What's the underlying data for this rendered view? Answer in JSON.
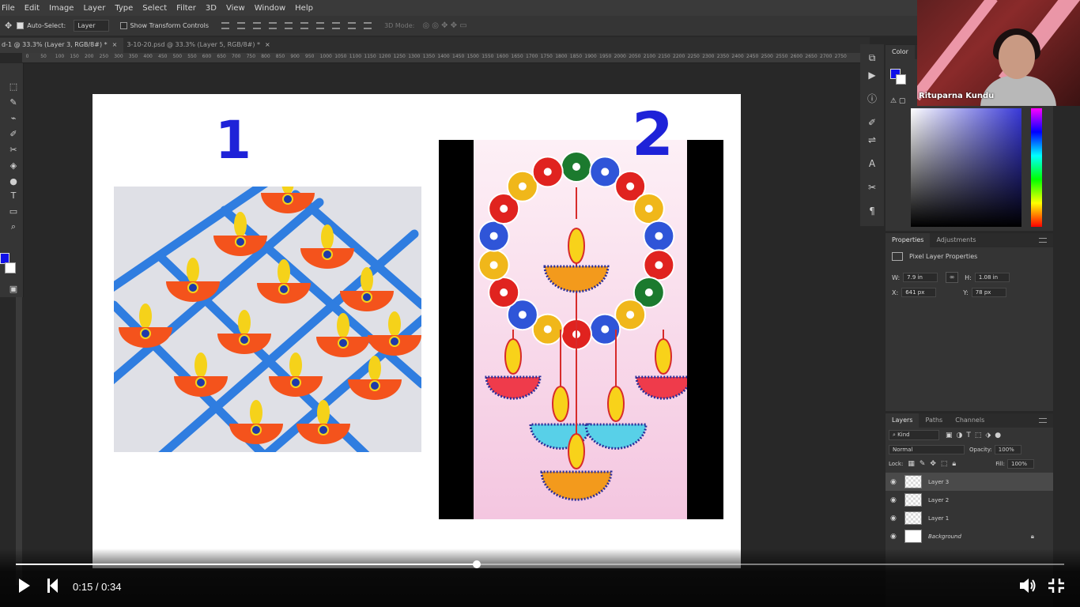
{
  "menu": [
    "File",
    "Edit",
    "Image",
    "Layer",
    "Type",
    "Select",
    "Filter",
    "3D",
    "View",
    "Window",
    "Help"
  ],
  "options": {
    "auto_select": "Auto-Select:",
    "auto_select_target": "Layer",
    "show_transform": "Show Transform Controls",
    "mode_3d": "3D Mode:"
  },
  "tabs": [
    {
      "label": "d-1 @ 33.3% (Layer 3, RGB/8#) *"
    },
    {
      "label": "3-10-20.psd @ 33.3% (Layer 5, RGB/8#) *"
    }
  ],
  "ruler": [
    "50",
    "0",
    "50",
    "100",
    "150",
    "200",
    "250",
    "300",
    "350",
    "400",
    "450",
    "500",
    "550",
    "600",
    "650",
    "700",
    "750",
    "800",
    "850",
    "900",
    "950",
    "1000",
    "1050",
    "1100",
    "1150",
    "1200",
    "1250",
    "1300",
    "1350",
    "1400",
    "1450",
    "1500",
    "1550",
    "1600",
    "1650",
    "1700",
    "1750",
    "1800",
    "1850",
    "1900",
    "1950",
    "2000",
    "2050",
    "2100",
    "2150",
    "2200",
    "2250",
    "2300",
    "2350",
    "2400",
    "2450",
    "2500",
    "2550",
    "2600",
    "2650",
    "2700",
    "2750"
  ],
  "canvas": {
    "label_1": "1",
    "label_2": "2"
  },
  "colors": {
    "foreground": "#1010e8",
    "background": "#ffffff",
    "accent": "#1e22d8"
  },
  "color_panel": {
    "title": "Color"
  },
  "properties": {
    "tabs": [
      "Properties",
      "Adjustments"
    ],
    "heading": "Pixel Layer Properties",
    "w_label": "W:",
    "w": "7.9 in",
    "h_label": "H:",
    "h": "1.08 in",
    "x_label": "X:",
    "x": "641 px",
    "y_label": "Y:",
    "y": "78 px"
  },
  "layers": {
    "tabs": [
      "Layers",
      "Paths",
      "Channels"
    ],
    "kind": "Kind",
    "blend": "Normal",
    "opacity_label": "Opacity:",
    "opacity": "100%",
    "lock_label": "Lock:",
    "fill_label": "Fill:",
    "fill": "100%",
    "items": [
      {
        "name": "Layer 3"
      },
      {
        "name": "Layer 2"
      },
      {
        "name": "Layer 1"
      },
      {
        "name": "Background"
      }
    ]
  },
  "webcam": {
    "name": "Rituparna Kundu"
  },
  "player": {
    "time": "0:15 / 0:34",
    "progress": 0.44
  }
}
